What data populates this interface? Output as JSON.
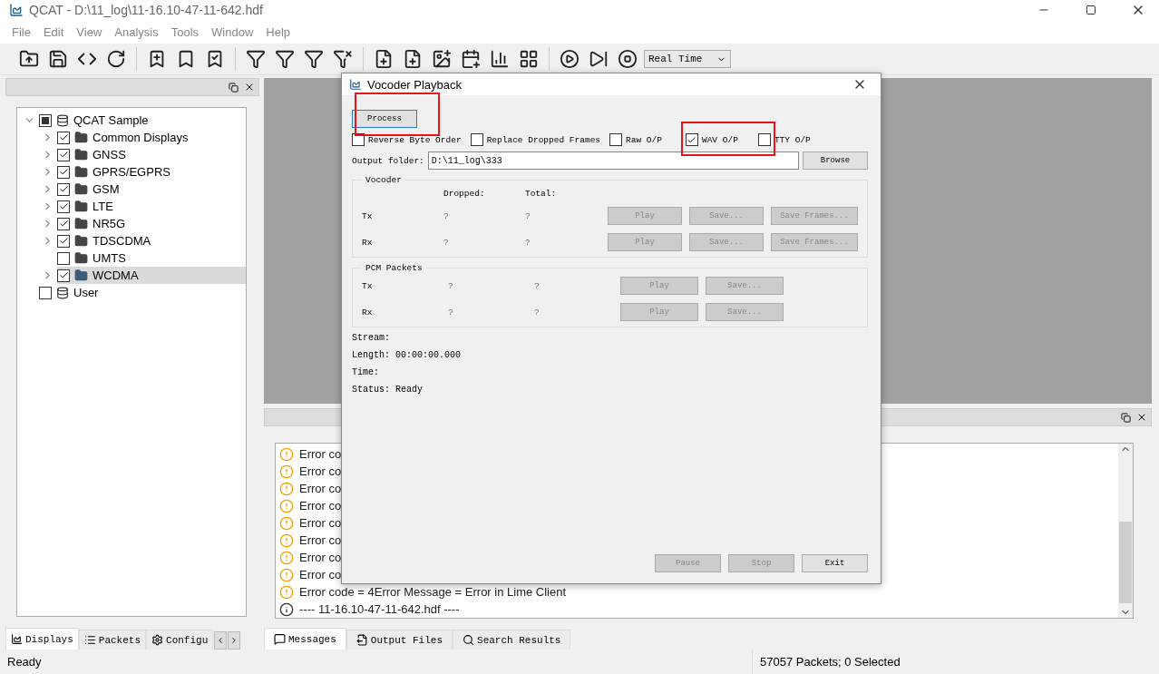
{
  "window": {
    "title": "QCAT - D:\\11_log\\11-16.10-47-11-642.hdf"
  },
  "menu": [
    "File",
    "Edit",
    "View",
    "Analysis",
    "Tools",
    "Window",
    "Help"
  ],
  "toolbar": {
    "mode_dropdown": "Real Time"
  },
  "tree": [
    {
      "label": "QCAT Sample",
      "kind": "database",
      "checked": true,
      "partial": true,
      "expanded": true,
      "selected": false,
      "children": [
        {
          "label": "Common Displays",
          "kind": "folder",
          "checked": true,
          "expanded": false,
          "selected": false
        },
        {
          "label": "GNSS",
          "kind": "folder",
          "checked": true,
          "expanded": false,
          "selected": false
        },
        {
          "label": "GPRS/EGPRS",
          "kind": "folder",
          "checked": true,
          "expanded": false,
          "selected": false
        },
        {
          "label": "GSM",
          "kind": "folder",
          "checked": true,
          "expanded": false,
          "selected": false
        },
        {
          "label": "LTE",
          "kind": "folder",
          "checked": true,
          "expanded": false,
          "selected": false
        },
        {
          "label": "NR5G",
          "kind": "folder",
          "checked": true,
          "expanded": false,
          "selected": false
        },
        {
          "label": "TDSCDMA",
          "kind": "folder",
          "checked": true,
          "expanded": false,
          "selected": false
        },
        {
          "label": "UMTS",
          "kind": "folder",
          "checked": false,
          "selected": false
        },
        {
          "label": "WCDMA",
          "kind": "folder",
          "checked": true,
          "expanded": false,
          "selected": true
        }
      ]
    },
    {
      "label": "User",
      "kind": "database",
      "checked": false,
      "selected": false
    }
  ],
  "left_tabs": [
    {
      "label": "Displays",
      "kind": "displays",
      "selected": true
    },
    {
      "label": "Packets",
      "kind": "packets",
      "selected": false
    },
    {
      "label": "Configu",
      "kind": "config",
      "selected": false
    }
  ],
  "dialog": {
    "title": "Vocoder Playback",
    "process_button": "Process",
    "options": [
      {
        "label": "Reverse Byte Order",
        "checked": false
      },
      {
        "label": "Replace Dropped Frames",
        "checked": false
      },
      {
        "label": "Raw O/P",
        "checked": false
      },
      {
        "label": "WAV O/P",
        "checked": true
      },
      {
        "label": "TTY O/P",
        "checked": false
      }
    ],
    "output_folder_label": "Output folder:",
    "output_folder": "D:\\11_log\\333",
    "browse_button": "Browse",
    "vocoder": {
      "title": "Vocoder",
      "headers": [
        "Dropped:",
        "Total:"
      ],
      "rows": [
        {
          "label": "Tx",
          "dropped": "?",
          "total": "?",
          "buttons": [
            {
              "label": "Play",
              "disabled": true
            },
            {
              "label": "Save...",
              "disabled": true
            },
            {
              "label": "Save Frames...",
              "disabled": true
            }
          ]
        },
        {
          "label": "Rx",
          "dropped": "?",
          "total": "?",
          "buttons": [
            {
              "label": "Play",
              "disabled": true
            },
            {
              "label": "Save...",
              "disabled": true
            },
            {
              "label": "Save Frames...",
              "disabled": true
            }
          ]
        }
      ]
    },
    "pcm": {
      "title": "PCM Packets",
      "rows": [
        {
          "label": "Tx",
          "dropped": "?",
          "total": "?",
          "buttons": [
            {
              "label": "Play",
              "disabled": true
            },
            {
              "label": "Save...",
              "disabled": true
            }
          ]
        },
        {
          "label": "Rx",
          "dropped": "?",
          "total": "?",
          "buttons": [
            {
              "label": "Play",
              "disabled": true
            },
            {
              "label": "Save...",
              "disabled": true
            }
          ]
        }
      ]
    },
    "info": [
      {
        "label": "Stream:"
      },
      {
        "label": "Length:",
        "value": "00:00:00.000"
      },
      {
        "label": "Time:"
      },
      {
        "label": "Status:",
        "value": "Ready"
      }
    ],
    "footer_buttons": [
      {
        "label": "Pause",
        "disabled": true
      },
      {
        "label": "Stop",
        "disabled": true
      },
      {
        "label": "Exit",
        "disabled": false
      }
    ]
  },
  "messages": [
    {
      "kind": "warning",
      "text": "Error co"
    },
    {
      "kind": "warning",
      "text": "Error co"
    },
    {
      "kind": "warning",
      "text": "Error co"
    },
    {
      "kind": "warning",
      "text": "Error co"
    },
    {
      "kind": "warning",
      "text": "Error co"
    },
    {
      "kind": "warning",
      "text": "Error co"
    },
    {
      "kind": "warning",
      "text": "Error co"
    },
    {
      "kind": "warning",
      "text": "Error co"
    },
    {
      "kind": "warning",
      "text": "Error code = 4Error Message = Error in Lime Client"
    },
    {
      "kind": "info",
      "text": "---- 11-16.10-47-11-642.hdf ----"
    }
  ],
  "bottom_tabs": [
    {
      "label": "Messages",
      "kind": "messages",
      "selected": true
    },
    {
      "label": "Output Files",
      "kind": "files",
      "selected": false
    },
    {
      "label": "Search Results",
      "kind": "search",
      "selected": false
    }
  ],
  "status_bar": {
    "left": "Ready",
    "right": "57057 Packets; 0 Selected"
  }
}
